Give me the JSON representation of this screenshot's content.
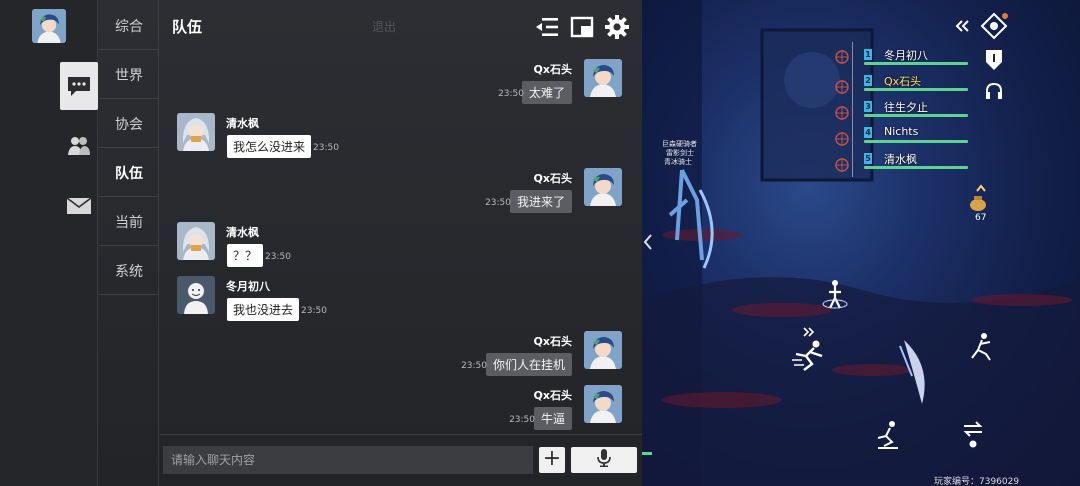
{
  "rail": {
    "items": [
      {
        "name": "avatar"
      },
      {
        "name": "chat-icon"
      },
      {
        "name": "friends-icon"
      },
      {
        "name": "mail-icon"
      }
    ]
  },
  "tabs": [
    {
      "label": "综合"
    },
    {
      "label": "世界"
    },
    {
      "label": "协会"
    },
    {
      "label": "队伍",
      "active": true
    },
    {
      "label": "当前"
    },
    {
      "label": "系统"
    }
  ],
  "header": {
    "title": "队伍",
    "ghost_text": "退出",
    "icons": [
      "list-collapse-icon",
      "window-mode-icon",
      "settings-gear-icon"
    ]
  },
  "messages": [
    {
      "side": "right",
      "name": "Qx石头",
      "text": "太难了",
      "time": "23:50",
      "avatar": "blue-hair"
    },
    {
      "side": "left",
      "name": "清水枫",
      "text": "我怎么没进来",
      "time": "23:50",
      "avatar": "white-hair"
    },
    {
      "side": "right",
      "name": "Qx石头",
      "text": "我进来了",
      "time": "23:50",
      "avatar": "blue-hair"
    },
    {
      "side": "left",
      "name": "清水枫",
      "text": "？？",
      "time": "23:50",
      "avatar": "white-hair"
    },
    {
      "side": "left",
      "name": "冬月初八",
      "text": "我也没进去",
      "time": "23:50",
      "avatar": "default"
    },
    {
      "side": "right",
      "name": "Qx石头",
      "text": "你们人在挂机",
      "time": "23:50",
      "avatar": "blue-hair"
    },
    {
      "side": "right",
      "name": "Qx石头",
      "text": "牛逼",
      "time": "23:50",
      "avatar": "blue-hair"
    }
  ],
  "input": {
    "placeholder": "请输入聊天内容",
    "plus_label": "+"
  },
  "game": {
    "party": [
      {
        "num": "1",
        "name": "冬月初八",
        "highlight": false
      },
      {
        "num": "2",
        "name": "Qx石头",
        "highlight": true
      },
      {
        "num": "3",
        "name": "往生夕止",
        "highlight": false
      },
      {
        "num": "4",
        "name": "Nichts",
        "highlight": false
      },
      {
        "num": "5",
        "name": "清水枫",
        "highlight": false
      }
    ],
    "coin_count": "67",
    "player_id": "玩家编号：7396029",
    "npc_labels": [
      "巨森硬骑者",
      "雷影剑士",
      "青冰骑士"
    ],
    "colors": {
      "party_bar": "#5cd48f",
      "highlight_name": "#ffe45a",
      "party_num": "#3ab7e8"
    }
  }
}
